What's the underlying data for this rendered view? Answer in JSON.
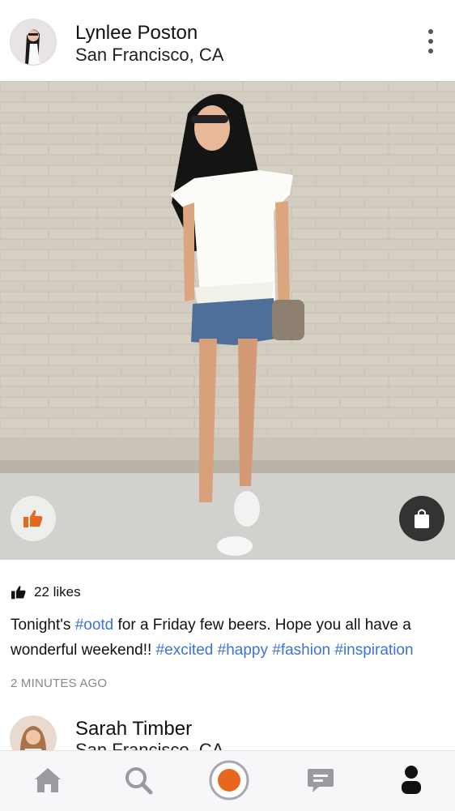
{
  "post": {
    "user_name": "Lynlee Poston",
    "location": "San Francisco, CA",
    "likes_text": "22 likes",
    "caption": {
      "p1": "Tonight's ",
      "tag1": "#ootd",
      "p2": " for a Friday few beers. Hope you all have a wonderful weekend!! ",
      "tag2": "#excited",
      "tag3": "#happy",
      "tag4": "#fashion",
      "tag5": "#inspiration"
    },
    "timestamp": "2 MINUTES AGO"
  },
  "next_post": {
    "user_name": "Sarah Timber",
    "location": "San Francisco, CA"
  },
  "tabbar": {
    "items": [
      "home-icon",
      "search-icon",
      "camera-record-icon",
      "messages-icon",
      "profile-icon"
    ],
    "active": "profile-icon"
  },
  "colors": {
    "accent": "#e8671f",
    "hashtag": "#3b73d9",
    "tab_inactive": "#9a9aa0",
    "tab_active": "#111111"
  }
}
